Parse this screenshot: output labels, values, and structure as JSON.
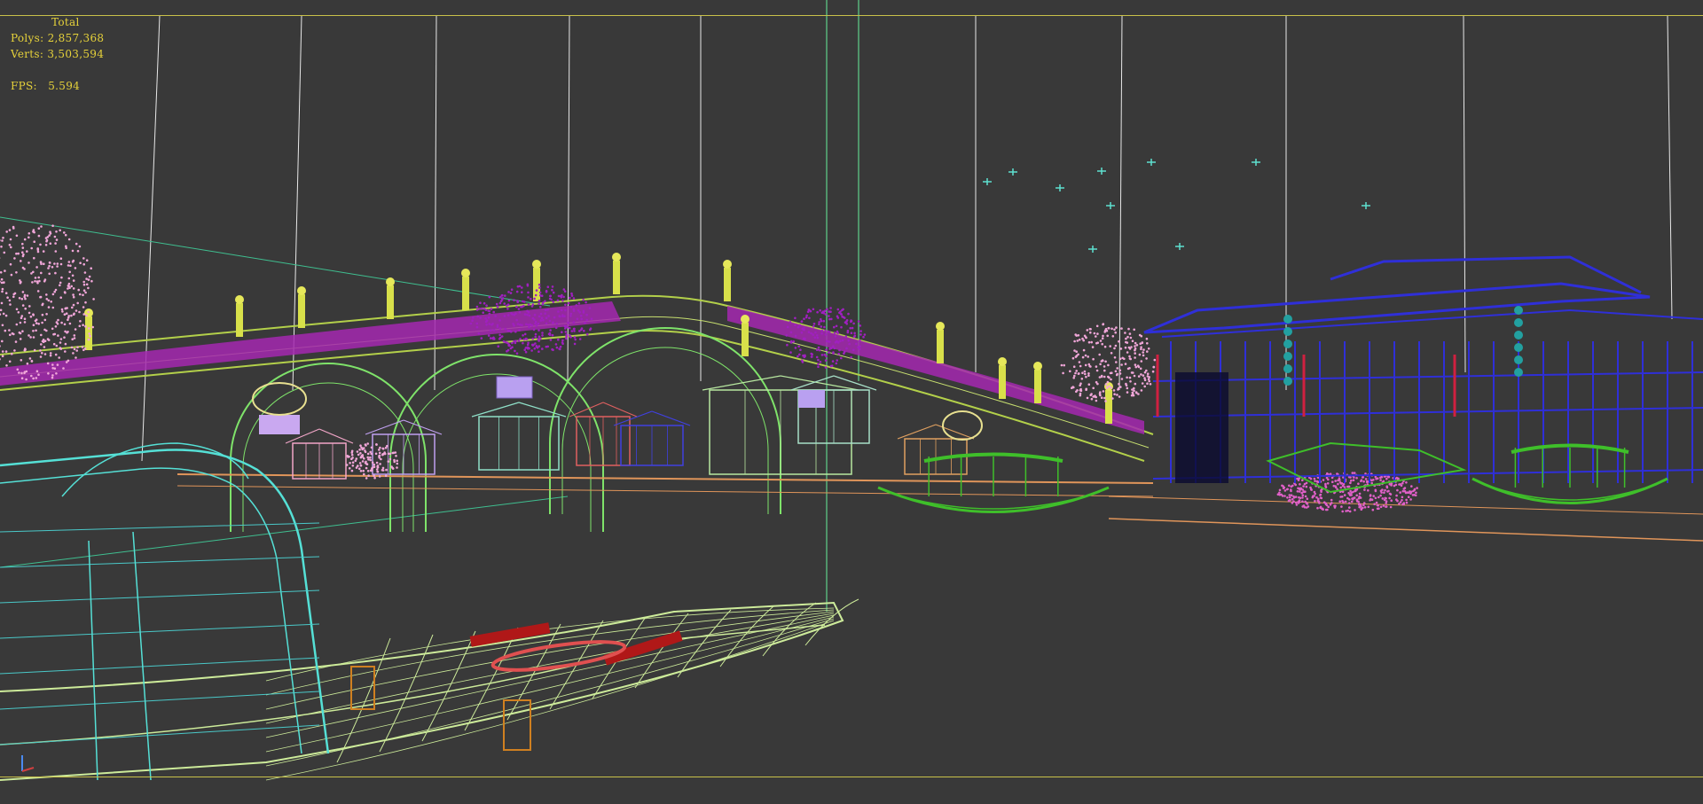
{
  "viewport": {
    "stats": {
      "total_label": "Total",
      "polys_label": "Polys:",
      "polys_value": "2,857,368",
      "verts_label": "Verts:",
      "verts_value": "3,503,594",
      "fps_label": "FPS:",
      "fps_value": "5.594"
    },
    "colors": {
      "background": "#393939",
      "safe_frame": "#c9c14a",
      "stats_text": "#e6d23a",
      "bridge_deck": "#b3d04a",
      "bridge_rail": "#a428b0",
      "arches": "#7fe36a",
      "pavilion": "#2f2fd8",
      "boat_foreground": "#cdeb9a",
      "boat_canopy": "#55e0d6",
      "blossom_pink": "#f0a6d8",
      "blossom_purple": "#a020c0",
      "boats_green": "#3fbf2a",
      "pier": "#e0955a",
      "red_props": "#b01818",
      "lights": "#5ee0d0"
    },
    "icons": [
      "axis-gizmo-icon"
    ]
  }
}
